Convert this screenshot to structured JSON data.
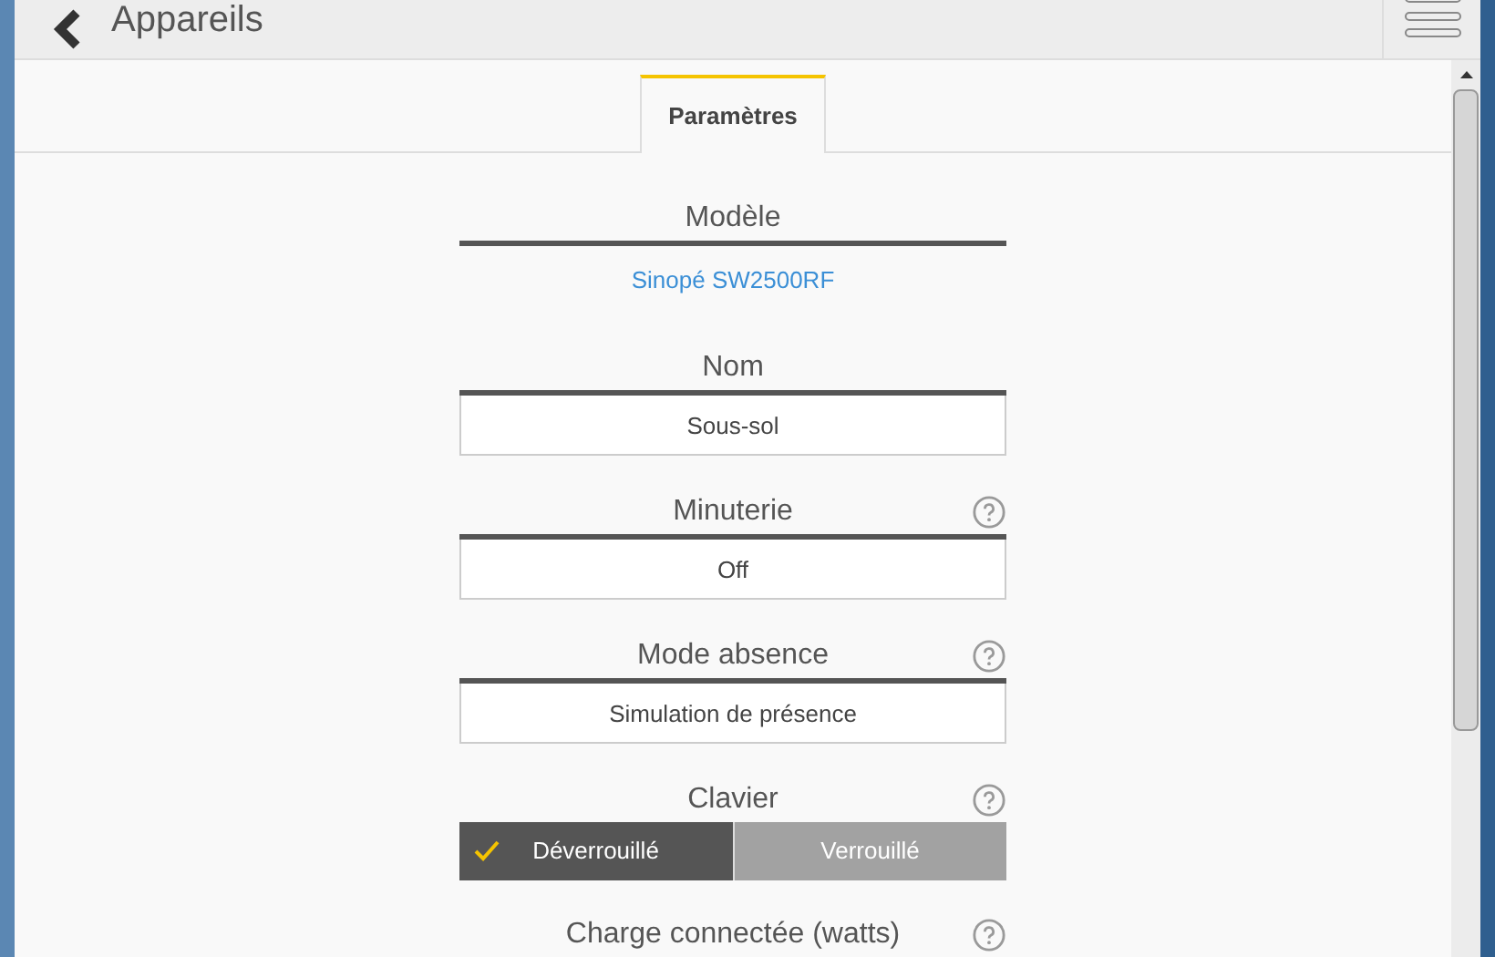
{
  "header": {
    "title": "Appareils"
  },
  "tabs": [
    {
      "label": "Paramètres",
      "selected": true
    }
  ],
  "fields": [
    {
      "kind": "text",
      "label": "Modèle",
      "help": false,
      "value": "Sinopé SW2500RF"
    },
    {
      "kind": "input",
      "label": "Nom",
      "help": false,
      "value": "Sous-sol"
    },
    {
      "kind": "input",
      "label": "Minuterie",
      "help": true,
      "value": "Off"
    },
    {
      "kind": "input",
      "label": "Mode absence",
      "help": true,
      "value": "Simulation de présence"
    },
    {
      "kind": "toggle",
      "label": "Clavier",
      "help": true,
      "options": [
        {
          "label": "Déverrouillé",
          "selected": true
        },
        {
          "label": "Verrouillé",
          "selected": false
        }
      ]
    },
    {
      "kind": "label",
      "label": "Charge connectée (watts)",
      "help": true
    }
  ]
}
